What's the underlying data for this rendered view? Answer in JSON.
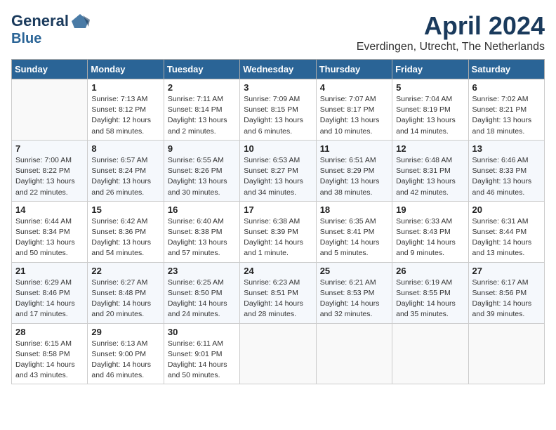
{
  "header": {
    "logo_line1": "General",
    "logo_line2": "Blue",
    "title": "April 2024",
    "location": "Everdingen, Utrecht, The Netherlands"
  },
  "weekdays": [
    "Sunday",
    "Monday",
    "Tuesday",
    "Wednesday",
    "Thursday",
    "Friday",
    "Saturday"
  ],
  "weeks": [
    [
      {
        "day": "",
        "info": ""
      },
      {
        "day": "1",
        "info": "Sunrise: 7:13 AM\nSunset: 8:12 PM\nDaylight: 12 hours\nand 58 minutes."
      },
      {
        "day": "2",
        "info": "Sunrise: 7:11 AM\nSunset: 8:14 PM\nDaylight: 13 hours\nand 2 minutes."
      },
      {
        "day": "3",
        "info": "Sunrise: 7:09 AM\nSunset: 8:15 PM\nDaylight: 13 hours\nand 6 minutes."
      },
      {
        "day": "4",
        "info": "Sunrise: 7:07 AM\nSunset: 8:17 PM\nDaylight: 13 hours\nand 10 minutes."
      },
      {
        "day": "5",
        "info": "Sunrise: 7:04 AM\nSunset: 8:19 PM\nDaylight: 13 hours\nand 14 minutes."
      },
      {
        "day": "6",
        "info": "Sunrise: 7:02 AM\nSunset: 8:21 PM\nDaylight: 13 hours\nand 18 minutes."
      }
    ],
    [
      {
        "day": "7",
        "info": "Sunrise: 7:00 AM\nSunset: 8:22 PM\nDaylight: 13 hours\nand 22 minutes."
      },
      {
        "day": "8",
        "info": "Sunrise: 6:57 AM\nSunset: 8:24 PM\nDaylight: 13 hours\nand 26 minutes."
      },
      {
        "day": "9",
        "info": "Sunrise: 6:55 AM\nSunset: 8:26 PM\nDaylight: 13 hours\nand 30 minutes."
      },
      {
        "day": "10",
        "info": "Sunrise: 6:53 AM\nSunset: 8:27 PM\nDaylight: 13 hours\nand 34 minutes."
      },
      {
        "day": "11",
        "info": "Sunrise: 6:51 AM\nSunset: 8:29 PM\nDaylight: 13 hours\nand 38 minutes."
      },
      {
        "day": "12",
        "info": "Sunrise: 6:48 AM\nSunset: 8:31 PM\nDaylight: 13 hours\nand 42 minutes."
      },
      {
        "day": "13",
        "info": "Sunrise: 6:46 AM\nSunset: 8:33 PM\nDaylight: 13 hours\nand 46 minutes."
      }
    ],
    [
      {
        "day": "14",
        "info": "Sunrise: 6:44 AM\nSunset: 8:34 PM\nDaylight: 13 hours\nand 50 minutes."
      },
      {
        "day": "15",
        "info": "Sunrise: 6:42 AM\nSunset: 8:36 PM\nDaylight: 13 hours\nand 54 minutes."
      },
      {
        "day": "16",
        "info": "Sunrise: 6:40 AM\nSunset: 8:38 PM\nDaylight: 13 hours\nand 57 minutes."
      },
      {
        "day": "17",
        "info": "Sunrise: 6:38 AM\nSunset: 8:39 PM\nDaylight: 14 hours\nand 1 minute."
      },
      {
        "day": "18",
        "info": "Sunrise: 6:35 AM\nSunset: 8:41 PM\nDaylight: 14 hours\nand 5 minutes."
      },
      {
        "day": "19",
        "info": "Sunrise: 6:33 AM\nSunset: 8:43 PM\nDaylight: 14 hours\nand 9 minutes."
      },
      {
        "day": "20",
        "info": "Sunrise: 6:31 AM\nSunset: 8:44 PM\nDaylight: 14 hours\nand 13 minutes."
      }
    ],
    [
      {
        "day": "21",
        "info": "Sunrise: 6:29 AM\nSunset: 8:46 PM\nDaylight: 14 hours\nand 17 minutes."
      },
      {
        "day": "22",
        "info": "Sunrise: 6:27 AM\nSunset: 8:48 PM\nDaylight: 14 hours\nand 20 minutes."
      },
      {
        "day": "23",
        "info": "Sunrise: 6:25 AM\nSunset: 8:50 PM\nDaylight: 14 hours\nand 24 minutes."
      },
      {
        "day": "24",
        "info": "Sunrise: 6:23 AM\nSunset: 8:51 PM\nDaylight: 14 hours\nand 28 minutes."
      },
      {
        "day": "25",
        "info": "Sunrise: 6:21 AM\nSunset: 8:53 PM\nDaylight: 14 hours\nand 32 minutes."
      },
      {
        "day": "26",
        "info": "Sunrise: 6:19 AM\nSunset: 8:55 PM\nDaylight: 14 hours\nand 35 minutes."
      },
      {
        "day": "27",
        "info": "Sunrise: 6:17 AM\nSunset: 8:56 PM\nDaylight: 14 hours\nand 39 minutes."
      }
    ],
    [
      {
        "day": "28",
        "info": "Sunrise: 6:15 AM\nSunset: 8:58 PM\nDaylight: 14 hours\nand 43 minutes."
      },
      {
        "day": "29",
        "info": "Sunrise: 6:13 AM\nSunset: 9:00 PM\nDaylight: 14 hours\nand 46 minutes."
      },
      {
        "day": "30",
        "info": "Sunrise: 6:11 AM\nSunset: 9:01 PM\nDaylight: 14 hours\nand 50 minutes."
      },
      {
        "day": "",
        "info": ""
      },
      {
        "day": "",
        "info": ""
      },
      {
        "day": "",
        "info": ""
      },
      {
        "day": "",
        "info": ""
      }
    ]
  ]
}
